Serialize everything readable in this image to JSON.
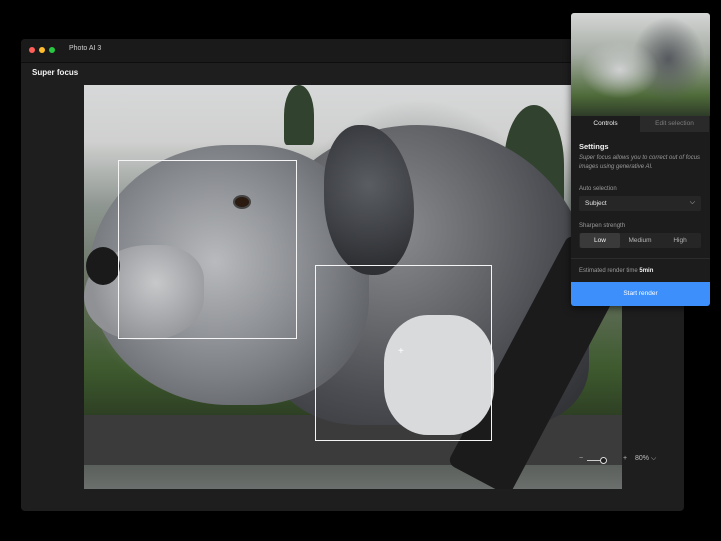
{
  "window": {
    "app_title": "Photo AI 3",
    "tool_title": "Super focus"
  },
  "canvas": {
    "selection_count": 2
  },
  "zoom": {
    "minus": "−",
    "plus": "+",
    "value": "80% ⌵"
  },
  "panel": {
    "tabs": [
      {
        "label": "Controls",
        "active": true
      },
      {
        "label": "Edit selection",
        "active": false
      }
    ],
    "heading": "Settings",
    "description": "Super focus allows you to correct out of focus images using generative AI.",
    "auto_selection": {
      "label": "Auto selection",
      "value": "Subject"
    },
    "sharpen_strength": {
      "label": "Sharpen strength",
      "options": [
        "Low",
        "Medium",
        "High"
      ],
      "selected": "Low"
    },
    "render": {
      "label": "Estimated render time",
      "value": "5min"
    },
    "start_button": "Start render"
  },
  "colors": {
    "accent": "#3d8ffb",
    "window_bg": "#1e1e1f"
  }
}
